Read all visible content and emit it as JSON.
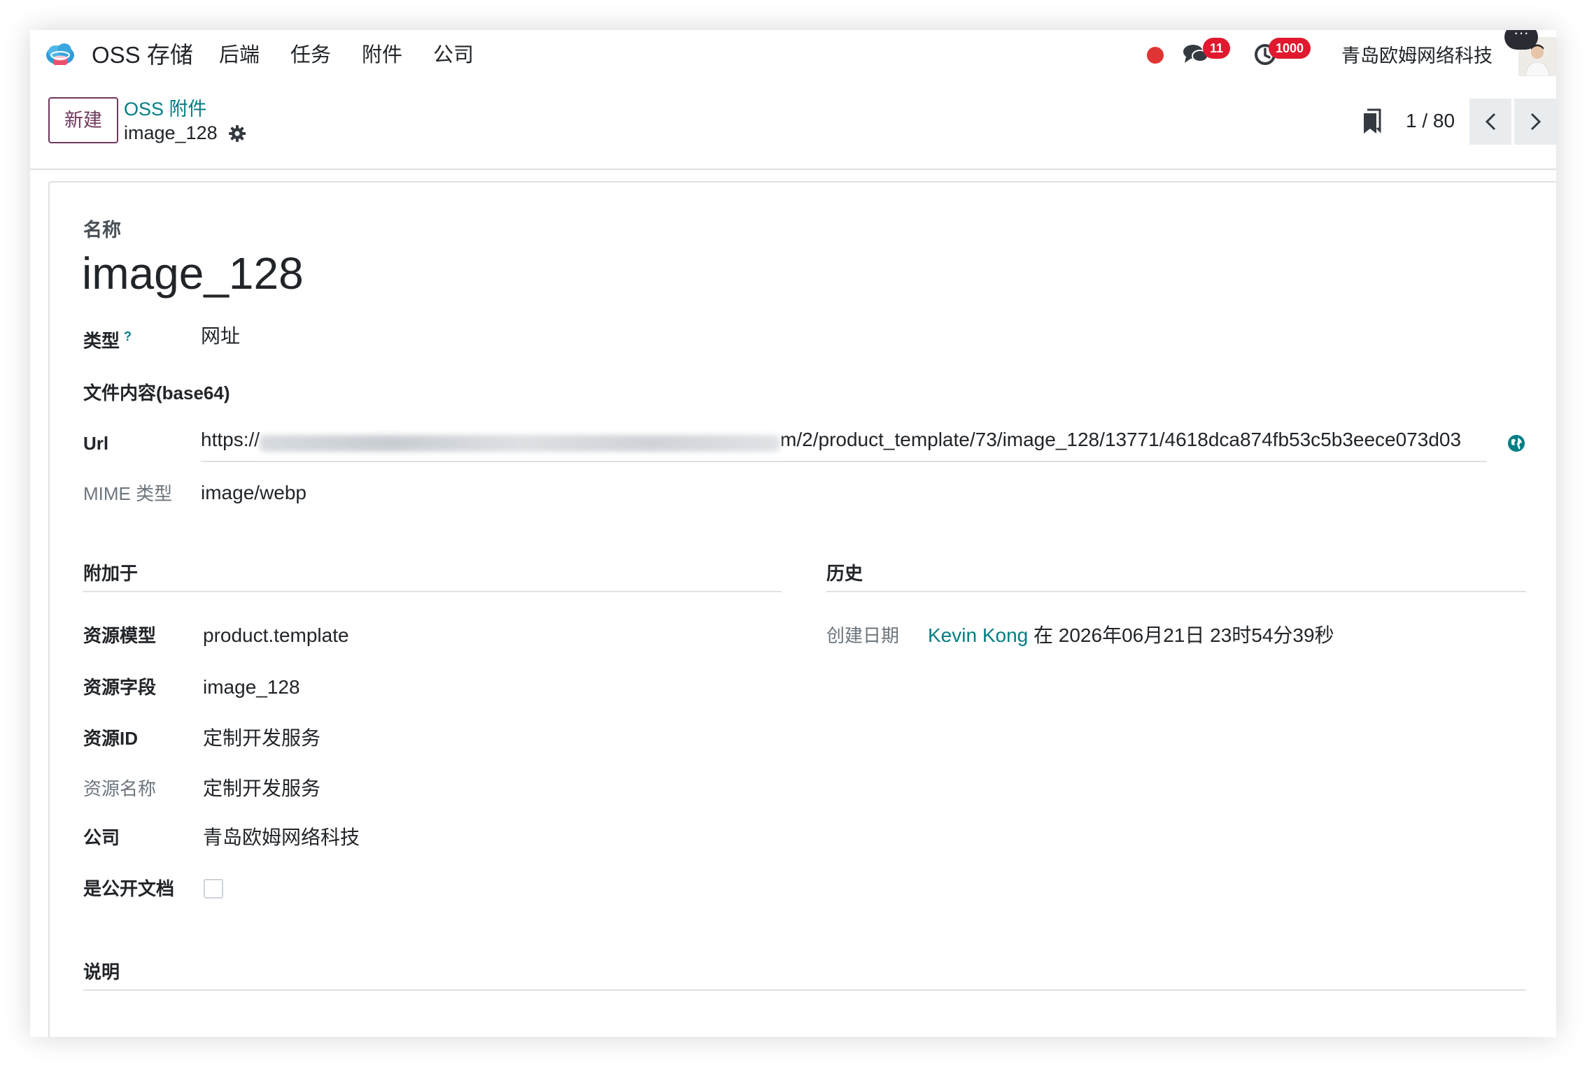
{
  "app": {
    "name": "OSS 存储",
    "menu": [
      "后端",
      "任务",
      "附件",
      "公司"
    ],
    "messages_badge": "11",
    "activities_badge": "1000",
    "company": "青岛欧姆网络科技",
    "more_label": "···"
  },
  "control": {
    "new_label": "新建",
    "breadcrumb_parent": "OSS 附件",
    "breadcrumb_current": "image_128",
    "pager_value": "1 / 80"
  },
  "form": {
    "name_label": "名称",
    "name_value": "image_128",
    "type_label": "类型",
    "type_help": "?",
    "type_value": "网址",
    "content_label": "文件内容(base64)",
    "url_label": "Url",
    "url_prefix": "https://",
    "url_suffix": "m/2/product_template/73/image_128/13771/4618dca874fb53c5b3eece073d03",
    "mime_label": "MIME 类型",
    "mime_value": "image/webp"
  },
  "attached": {
    "section_title": "附加于",
    "rows": [
      {
        "label": "资源模型",
        "value": "product.template",
        "muted": false
      },
      {
        "label": "资源字段",
        "value": "image_128",
        "muted": false
      },
      {
        "label": "资源ID",
        "value": "定制开发服务",
        "muted": false
      },
      {
        "label": "资源名称",
        "value": "定制开发服务",
        "muted": true
      },
      {
        "label": "公司",
        "value": "青岛欧姆网络科技",
        "muted": false
      }
    ],
    "public_label": "是公开文档",
    "public_checked": false
  },
  "history": {
    "section_title": "历史",
    "created_label": "创建日期",
    "created_by": "Kevin Kong",
    "created_at": "在 2026年06月21日 23时54分39秒"
  },
  "description": {
    "section_title": "说明"
  },
  "colors": {
    "brand": "#71385f",
    "link": "#017e84",
    "badge": "#e0192e"
  }
}
